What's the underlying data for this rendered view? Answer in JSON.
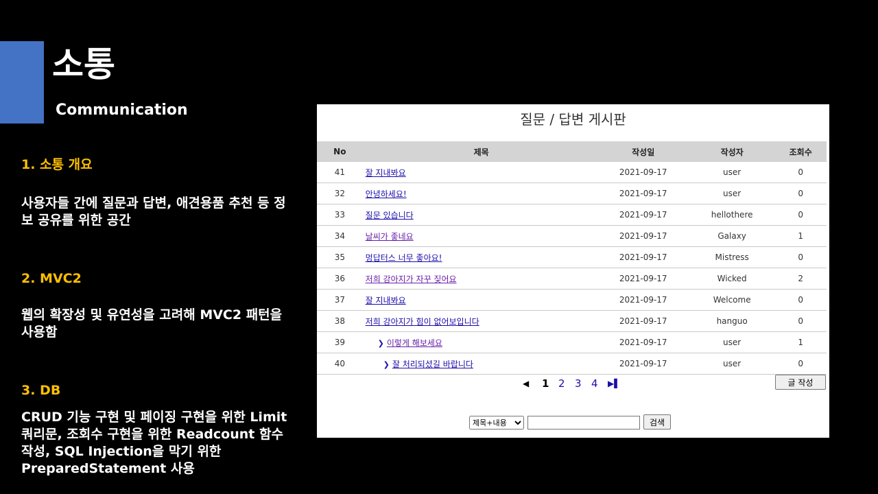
{
  "slide": {
    "title": "소통",
    "subtitle": "Communication",
    "sections": [
      {
        "heading": "1. 소통 개요",
        "body": "사용자들 간에 질문과 답변, 애견용품 추천 등 정보 공유를 위한 공간"
      },
      {
        "heading": "2. MVC2",
        "body": "웹의 확장성 및 유연성을 고려해 MVC2 패턴을 사용함"
      },
      {
        "heading": "3. DB",
        "body": "CRUD 기능 구현 및 페이징 구현을 위한 Limit 쿼리문, 조회수 구현을 위한 Readcount 함수 작성, SQL Injection을 막기 위한 PreparedStatement 사용"
      }
    ]
  },
  "colors": {
    "accent": "#4472c4",
    "heading": "#ffc000",
    "link": "#1a0dab",
    "visited": "#681da8"
  },
  "board": {
    "title": "질문 / 답변 게시판",
    "columns": {
      "no": "No",
      "title": "제목",
      "date": "작성일",
      "author": "작성자",
      "views": "조회수"
    },
    "rows": [
      {
        "no": "41",
        "title": "잘 지내봐요",
        "date": "2021-09-17",
        "author": "user",
        "views": "0",
        "depth": 0,
        "visited": false
      },
      {
        "no": "32",
        "title": "안녕하세요!",
        "date": "2021-09-17",
        "author": "user",
        "views": "0",
        "depth": 0,
        "visited": false
      },
      {
        "no": "33",
        "title": "질문 있습니다",
        "date": "2021-09-17",
        "author": "hellothere",
        "views": "0",
        "depth": 0,
        "visited": false
      },
      {
        "no": "34",
        "title": "날씨가 좋네요",
        "date": "2021-09-17",
        "author": "Galaxy",
        "views": "1",
        "depth": 0,
        "visited": true
      },
      {
        "no": "35",
        "title": "멍답터스 너무 좋아요!",
        "date": "2021-09-17",
        "author": "Mistress",
        "views": "0",
        "depth": 0,
        "visited": false
      },
      {
        "no": "36",
        "title": "저희 강아지가 자꾸 짖어요",
        "date": "2021-09-17",
        "author": "Wicked",
        "views": "2",
        "depth": 0,
        "visited": true
      },
      {
        "no": "37",
        "title": "잘 지내봐요",
        "date": "2021-09-17",
        "author": "Welcome",
        "views": "0",
        "depth": 0,
        "visited": false
      },
      {
        "no": "38",
        "title": "저희 강아지가 힘이 없어보입니다",
        "date": "2021-09-17",
        "author": "hanguo",
        "views": "0",
        "depth": 0,
        "visited": false
      },
      {
        "no": "39",
        "title": "이렇게 해보세요",
        "date": "2021-09-17",
        "author": "user",
        "views": "1",
        "depth": 1,
        "visited": true
      },
      {
        "no": "40",
        "title": "잘 처리되셨길 바랍니다",
        "date": "2021-09-17",
        "author": "user",
        "views": "0",
        "depth": 2,
        "visited": false
      }
    ],
    "reply_icon": "chevron-right-icon",
    "pagination": {
      "prev_icon": "triangle-left-icon",
      "next_icon": "triangle-right-icon",
      "pages": [
        "1",
        "2",
        "3",
        "4"
      ],
      "current": "1"
    },
    "write_button": "글 작성",
    "search": {
      "selected_option": "제목+내용",
      "input_value": "",
      "button": "검색"
    }
  }
}
